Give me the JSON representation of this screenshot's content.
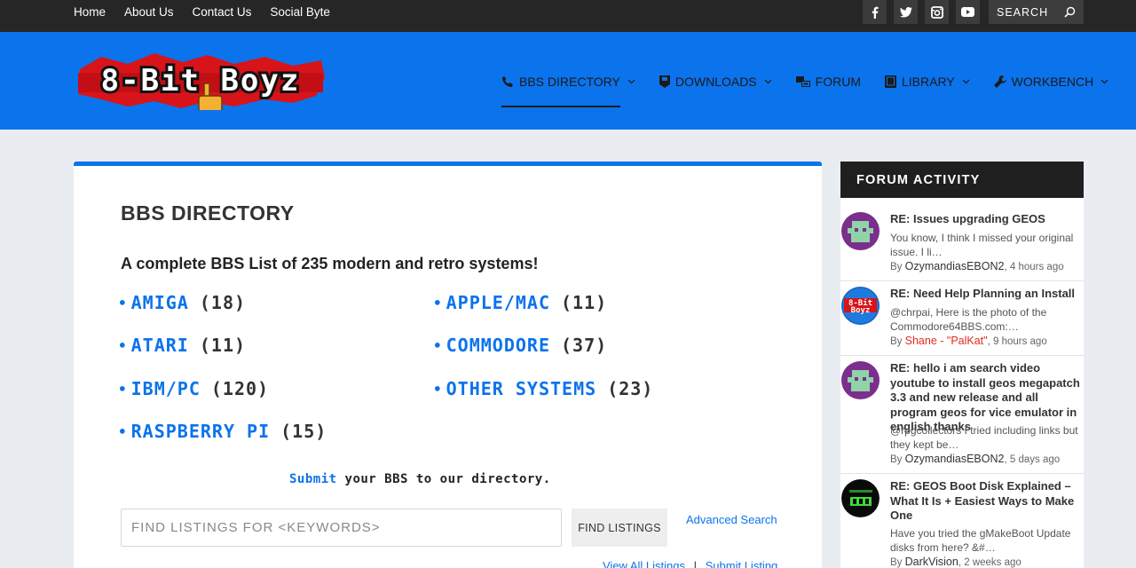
{
  "top_nav": {
    "items": [
      "Home",
      "About Us",
      "Contact Us",
      "Social Byte"
    ]
  },
  "top_search": {
    "label": "SEARCH"
  },
  "social_icons": [
    "facebook-icon",
    "twitter-icon",
    "instagram-icon",
    "youtube-icon"
  ],
  "logo": {
    "text": "8-Bit Boyz"
  },
  "main_nav": [
    {
      "label": "BBS DIRECTORY",
      "icon": "phone-icon",
      "dropdown": true,
      "active": true
    },
    {
      "label": "DOWNLOADS",
      "icon": "floppy-icon",
      "dropdown": true,
      "active": false
    },
    {
      "label": "FORUM",
      "icon": "chat-icon",
      "dropdown": false,
      "active": false
    },
    {
      "label": "LIBRARY",
      "icon": "book-icon",
      "dropdown": true,
      "active": false
    },
    {
      "label": "WORKBENCH",
      "icon": "wrench-icon",
      "dropdown": true,
      "active": false
    }
  ],
  "directory": {
    "title": "BBS DIRECTORY",
    "intro": "A complete BBS List of 235 modern and retro systems!",
    "categories": [
      {
        "name": "AMIGA",
        "count": "(18)"
      },
      {
        "name": "APPLE/MAC",
        "count": "(11)"
      },
      {
        "name": "ATARI",
        "count": "(11)"
      },
      {
        "name": "COMMODORE",
        "count": "(37)"
      },
      {
        "name": "IBM/PC",
        "count": "(120)"
      },
      {
        "name": "OTHER SYSTEMS",
        "count": "(23)"
      },
      {
        "name": "RASPBERRY PI",
        "count": "(15)"
      }
    ],
    "submit_link": "Submit",
    "submit_rest": "your BBS to our directory.",
    "search_placeholder": "FIND LISTINGS FOR <KEYWORDS>",
    "find_button": "FIND LISTINGS",
    "advanced_search": "Advanced Search",
    "view_all": "View All Listings",
    "separator": "|",
    "submit_listing": "Submit Listing"
  },
  "sidebar": {
    "title": "FORUM ACTIVITY",
    "posts": [
      {
        "title": "RE: Issues upgrading GEOS",
        "excerpt": "You know, I think I missed your original issue. I li…",
        "by": "By",
        "author": "OzymandiasEBON2",
        "time": ", 4 hours ago",
        "author_color": "#333333"
      },
      {
        "title": "RE: Need Help Planning an Install",
        "excerpt": "@chrpai, Here is the photo of the Commodore64BBS.com:…",
        "by": "By",
        "author": "Shane - \"PalKat\"",
        "time": ", 9 hours ago",
        "author_color": "#e02b20"
      },
      {
        "title": "RE: hello i am search video youtube to install geos megapatch 3.3 and new release and all program geos for vice emulator in english thanks",
        "excerpt": "@rpgcollectors I tried including links but they kept be…",
        "by": "By",
        "author": "OzymandiasEBON2",
        "time": ", 5 days ago",
        "author_color": "#333333"
      },
      {
        "title": "RE: GEOS Boot Disk Explained – What It Is + Easiest Ways to Make One",
        "excerpt": "Have you tried the gMakeBoot Update disks from here? &#…",
        "by": "By",
        "author": "DarkVision",
        "time": ", 2 weeks ago",
        "author_color": "#333333"
      }
    ]
  },
  "colors": {
    "accent": "#0b73ec",
    "topbar": "#262626",
    "header": "#0b73ec",
    "page_bg": "#e9edf2",
    "author_highlight": "#e02b20"
  }
}
